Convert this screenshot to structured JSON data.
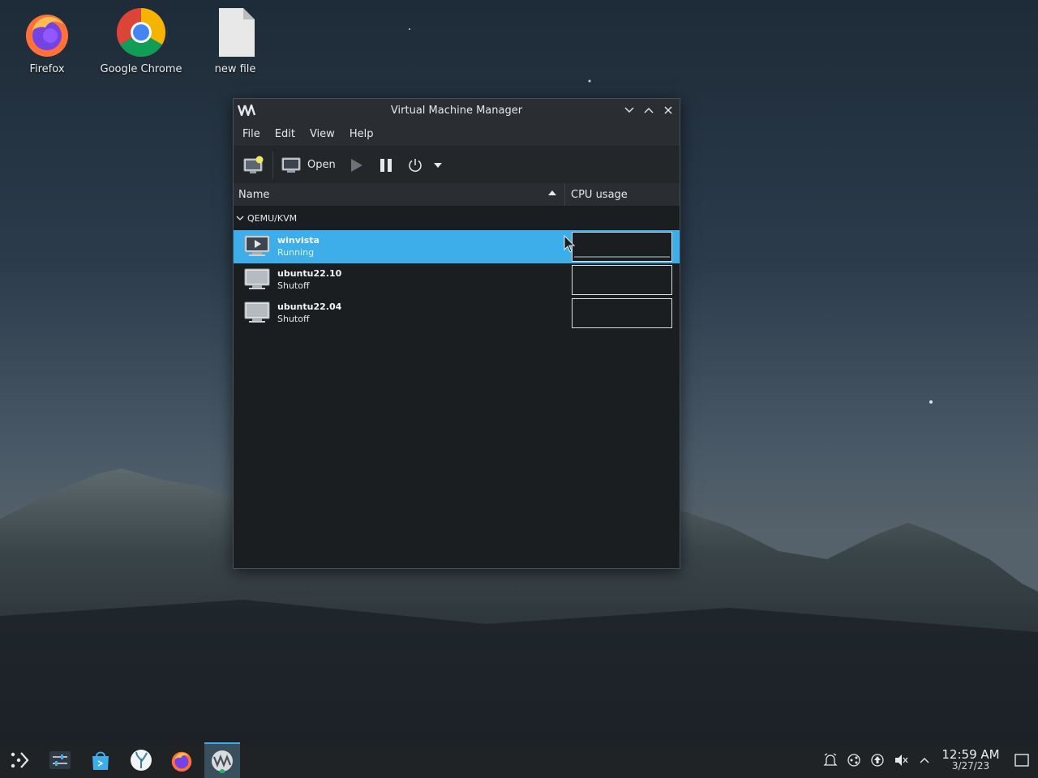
{
  "desktop": {
    "icons": [
      {
        "label": "Firefox",
        "icon": "firefox-icon"
      },
      {
        "label": "Google Chrome",
        "icon": "chrome-icon"
      },
      {
        "label": "new file",
        "icon": "file-icon"
      }
    ]
  },
  "window": {
    "title": "Virtual Machine Manager",
    "menu": [
      "File",
      "Edit",
      "View",
      "Help"
    ],
    "toolbar": {
      "open_label": "Open"
    },
    "columns": {
      "name": "Name",
      "cpu": "CPU usage"
    },
    "group": "QEMU/KVM",
    "vms": [
      {
        "name": "winvista",
        "status": "Running",
        "selected": true
      },
      {
        "name": "ubuntu22.10",
        "status": "Shutoff",
        "selected": false
      },
      {
        "name": "ubuntu22.04",
        "status": "Shutoff",
        "selected": false
      }
    ]
  },
  "taskbar": {
    "clock": {
      "time": "12:59 AM",
      "date": "3/27/23"
    }
  },
  "colors": {
    "accent": "#3daee9",
    "window_bg": "#1b1e20",
    "titlebar_bg": "#2a2e32"
  }
}
